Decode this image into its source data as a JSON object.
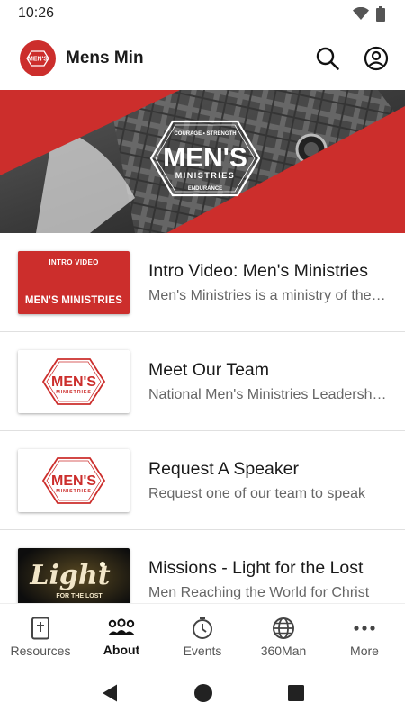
{
  "status_bar": {
    "time": "10:26",
    "icons": [
      "wifi-icon",
      "battery-icon"
    ]
  },
  "app_bar": {
    "title": "Mens Min",
    "logo_text": "MEN'S",
    "actions": [
      "search-icon",
      "account-icon"
    ]
  },
  "hero": {
    "logo_top": "COURAGE • STRENGTH",
    "logo_main": "MEN'S",
    "logo_sub": "MINISTRIES",
    "logo_bottom": "ENDURANCE"
  },
  "list_items": [
    {
      "title": "Intro Video: Men's Ministries",
      "subtitle": "Men's Ministries is a ministry of the Assemblies of God",
      "thumb_line1": "INTRO VIDEO",
      "thumb_line2": "MEN'S MINISTRIES"
    },
    {
      "title": "Meet Our Team",
      "subtitle": "National Men's Ministries Leadership Team",
      "thumb_main": "MEN'S",
      "thumb_sub": "MINISTRIES"
    },
    {
      "title": "Request A Speaker",
      "subtitle": "Request one of our team to speak",
      "thumb_main": "MEN'S",
      "thumb_sub": "MINISTRIES"
    },
    {
      "title": "Missions - Light for the Lost",
      "subtitle": "Men Reaching the World for Christ",
      "thumb_main": "Light",
      "thumb_sub": "FOR THE LOST"
    }
  ],
  "bottom_nav": {
    "tabs": [
      {
        "label": "Resources",
        "icon": "bible-icon",
        "active": false
      },
      {
        "label": "About",
        "icon": "group-icon",
        "active": true
      },
      {
        "label": "Events",
        "icon": "clock-icon",
        "active": false
      },
      {
        "label": "360Man",
        "icon": "globe-icon",
        "active": false
      },
      {
        "label": "More",
        "icon": "more-icon",
        "active": false
      }
    ]
  },
  "colors": {
    "brand_red": "#cc2e2c",
    "text_primary": "#1a1a1a",
    "text_secondary": "#666666"
  }
}
